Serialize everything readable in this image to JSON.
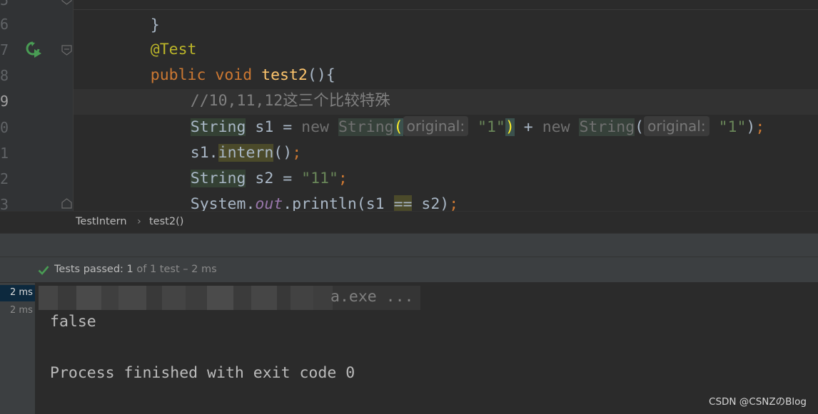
{
  "gutter": {
    "line_numbers": [
      "5",
      "6",
      "7",
      "8",
      "9",
      "0",
      "1",
      "2",
      "3"
    ]
  },
  "code": {
    "line0": {
      "brace": "}"
    },
    "line1": {
      "annotation": "@Test"
    },
    "line2": {
      "kw_public": "public",
      "kw_void": "void",
      "method": "test2",
      "parens": "(){"
    },
    "line3": {
      "comment": "//10,11,12这三个比较特殊"
    },
    "line4": {
      "type": "String",
      "var": "s1",
      "eq": "=",
      "kw_new": "new",
      "type2": "String",
      "lparen": "(",
      "hint": "original:",
      "arg": "\"1\"",
      "rparen": ")",
      "plus": "+",
      "kw_new2": "new",
      "type3": "String",
      "lparen2": "(",
      "hint2": "original:",
      "arg2": "\"1\"",
      "rparen2": ")",
      "semi": ";"
    },
    "line5": {
      "obj": "s1.",
      "method": "intern",
      "tail": "()",
      "semi": ";"
    },
    "line6": {
      "type": "String",
      "rest": " s2 = ",
      "str": "\"11\"",
      "semi": ";"
    },
    "line7": {
      "sys": "System.",
      "field": "out",
      "call": ".println(s1 ",
      "eqeq": "==",
      "rest": " s2)",
      "semi": ";"
    },
    "line8": {
      "brace": "}"
    }
  },
  "breadcrumb": {
    "class_name": "TestIntern",
    "separator": "›",
    "method_name": "test2()"
  },
  "status": {
    "prefix": "Tests passed:",
    "count": "1",
    "suffix": "of 1 test – 2 ms"
  },
  "tree": {
    "root_time": "2 ms",
    "child_time": "2 ms"
  },
  "console": {
    "cmd_visible": "a.exe ...",
    "output": "false",
    "finish": "Process finished with exit code 0"
  },
  "watermark": "CSDN @CSNZのBlog",
  "colors": {
    "keyword": "#cc7832",
    "string": "#6a8759",
    "annotation": "#bbb529",
    "method": "#ffc66d",
    "pass_green": "#499c54"
  },
  "icons": [
    "run-test-icon",
    "fold-icon",
    "bulb-icon",
    "check-icon"
  ]
}
